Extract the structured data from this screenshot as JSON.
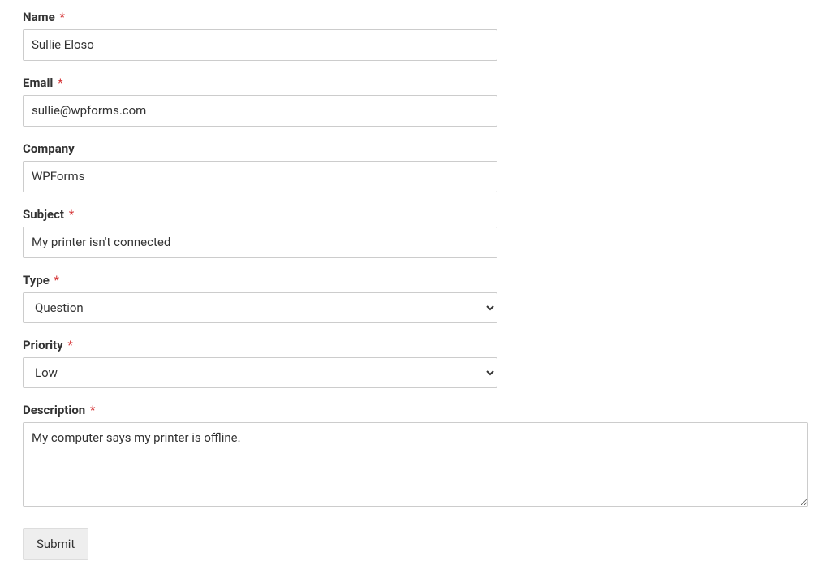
{
  "form": {
    "name": {
      "label": "Name",
      "required": true,
      "value": "Sullie Eloso"
    },
    "email": {
      "label": "Email",
      "required": true,
      "value": "sullie@wpforms.com"
    },
    "company": {
      "label": "Company",
      "required": false,
      "value": "WPForms"
    },
    "subject": {
      "label": "Subject",
      "required": true,
      "value": "My printer isn't connected"
    },
    "type": {
      "label": "Type",
      "required": true,
      "value": "Question"
    },
    "priority": {
      "label": "Priority",
      "required": true,
      "value": "Low"
    },
    "description": {
      "label": "Description",
      "required": true,
      "value": "My computer says my printer is offline."
    },
    "submit_label": "Submit",
    "asterisk": "*"
  }
}
